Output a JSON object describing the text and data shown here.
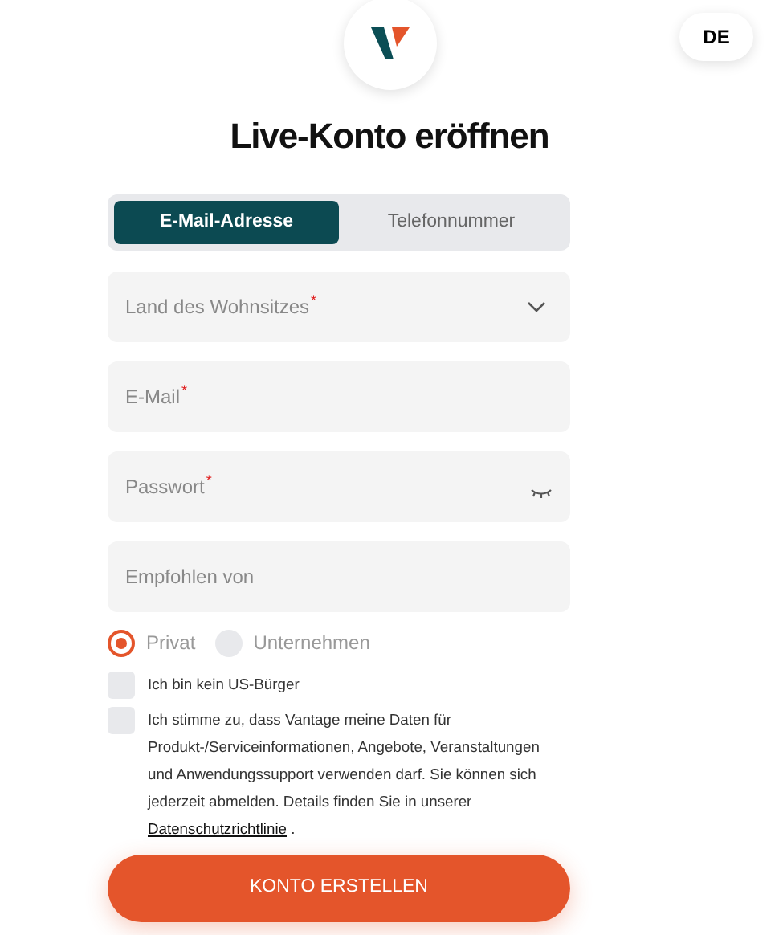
{
  "language_button": "DE",
  "title": "Live-Konto eröffnen",
  "tabs": [
    {
      "label": "E-Mail-Adresse",
      "selected": true
    },
    {
      "label": "Telefonnummer",
      "selected": false
    }
  ],
  "fields": [
    {
      "kind": "select",
      "placeholder": "Land des Wohnsitzes",
      "required_mark": "*"
    },
    {
      "kind": "text",
      "placeholder": "E-Mail",
      "required_mark": "*"
    },
    {
      "kind": "password",
      "placeholder": "Passwort",
      "required_mark": "*"
    },
    {
      "kind": "text",
      "placeholder": "Empfohlen von"
    }
  ],
  "account_types": [
    {
      "label": "Privat",
      "selected": true
    },
    {
      "label": "Unternehmen",
      "selected": false
    }
  ],
  "checkboxes": [
    {
      "text": "Ich bin kein US-Bürger",
      "checked": false
    },
    {
      "text": "Ich stimme zu, dass Vantage meine Daten für Produkt-/Serviceinformationen, Angebote, Veranstaltungen und Anwendungssupport verwenden darf. Sie können sich jederzeit abmelden. Details finden Sie in unserer",
      "link": "Datenschutzrichtlinie",
      "text_after": ".",
      "checked": false
    }
  ],
  "submit_button": "KONTO ERSTELLEN"
}
